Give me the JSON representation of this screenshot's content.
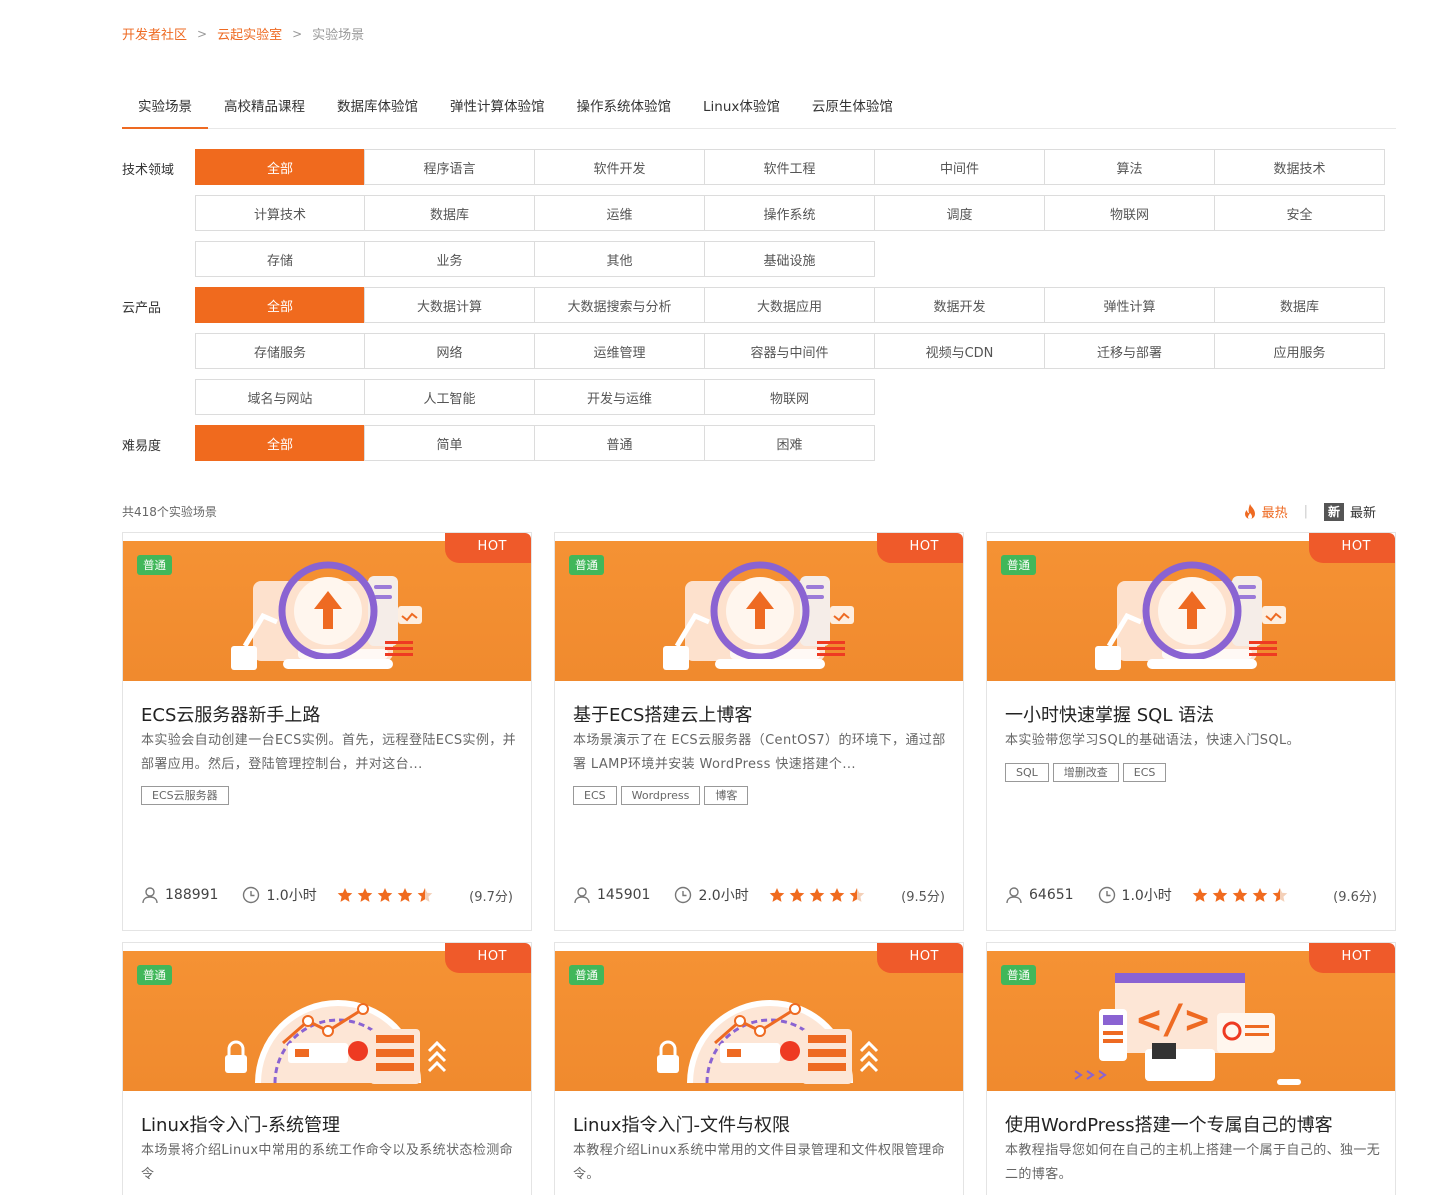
{
  "breadcrumb": {
    "items": [
      "开发者社区",
      "云起实验室",
      "实验场景"
    ],
    "separator": ">"
  },
  "tabs": [
    "实验场景",
    "高校精品课程",
    "数据库体验馆",
    "弹性计算体验馆",
    "操作系统体验馆",
    "Linux体验馆",
    "云原生体验馆"
  ],
  "filters": {
    "tech": {
      "label": "技术领域",
      "options": [
        "全部",
        "程序语言",
        "软件开发",
        "软件工程",
        "中间件",
        "算法",
        "数据技术",
        "计算技术",
        "数据库",
        "运维",
        "操作系统",
        "调度",
        "物联网",
        "安全",
        "存储",
        "业务",
        "其他",
        "基础设施"
      ]
    },
    "product": {
      "label": "云产品",
      "options": [
        "全部",
        "大数据计算",
        "大数据搜索与分析",
        "大数据应用",
        "数据开发",
        "弹性计算",
        "数据库",
        "存储服务",
        "网络",
        "运维管理",
        "容器与中间件",
        "视频与CDN",
        "迁移与部署",
        "应用服务",
        "域名与网站",
        "人工智能",
        "开发与运维",
        "物联网"
      ]
    },
    "difficulty": {
      "label": "难易度",
      "options": [
        "全部",
        "简单",
        "普通",
        "困难"
      ]
    }
  },
  "total": "共418个实验场景",
  "sort": {
    "hot": "最热",
    "new_badge": "新",
    "new": "最新"
  },
  "colors": {
    "accent": "#ee6a22",
    "level": "#41b75a",
    "hot": "#ef5a2a",
    "star": "#f06a1e"
  },
  "cards": [
    {
      "hot": "HOT",
      "level": "普通",
      "art": "cloud-upload",
      "title": "ECS云服务器新手上路",
      "desc": "本实验会自动创建一台ECS实例。首先，远程登陆ECS实例，并部署应用。然后，登陆管理控制台，并对这台...",
      "tags": [
        "ECS云服务器"
      ],
      "users": "188991",
      "duration": "1.0小时",
      "rating": 4.5,
      "score": "(9.7分)"
    },
    {
      "hot": "HOT",
      "level": "普通",
      "art": "cloud-upload",
      "title": "基于ECS搭建云上博客",
      "desc": "本场景演示了在 ECS云服务器（CentOS7）的环境下，通过部署 LAMP环境并安装 WordPress 快速搭建个...",
      "tags": [
        "ECS",
        "Wordpress",
        "博客"
      ],
      "users": "145901",
      "duration": "2.0小时",
      "rating": 4.5,
      "score": "(9.5分)"
    },
    {
      "hot": "HOT",
      "level": "普通",
      "art": "cloud-upload",
      "title": "一小时快速掌握 SQL 语法",
      "desc": "本实验带您学习SQL的基础语法，快速入门SQL。",
      "tags": [
        "SQL",
        "增删改查",
        "ECS"
      ],
      "users": "64651",
      "duration": "1.0小时",
      "rating": 4.5,
      "score": "(9.6分)"
    },
    {
      "hot": "HOT",
      "level": "普通",
      "art": "gauge",
      "title": "Linux指令入门-系统管理",
      "desc": "本场景将介绍Linux中常用的系统工作命令以及系统状态检测命令",
      "tags": [],
      "users": "",
      "duration": "",
      "rating": 0,
      "score": ""
    },
    {
      "hot": "HOT",
      "level": "普通",
      "art": "gauge",
      "title": "Linux指令入门-文件与权限",
      "desc": "本教程介绍Linux系统中常用的文件目录管理和文件权限管理命令。",
      "tags": [],
      "users": "",
      "duration": "",
      "rating": 0,
      "score": ""
    },
    {
      "hot": "HOT",
      "level": "普通",
      "art": "code",
      "title": "使用WordPress搭建一个专属自己的博客",
      "desc": "本教程指导您如何在自己的主机上搭建一个属于自己的、独一无二的博客。",
      "tags": [],
      "users": "",
      "duration": "",
      "rating": 0,
      "score": ""
    }
  ]
}
